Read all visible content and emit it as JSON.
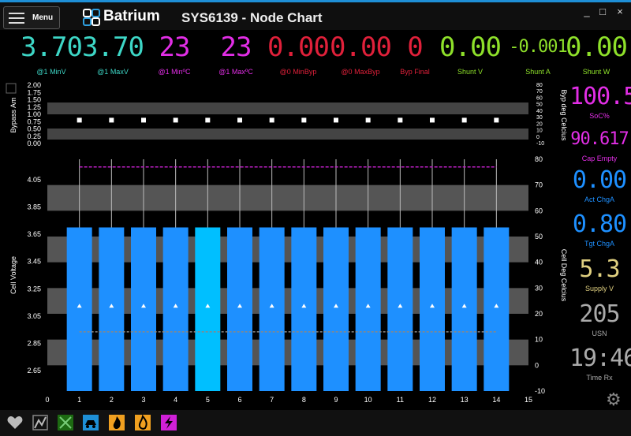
{
  "window": {
    "menu_label": "Menu",
    "brand": "Batrium",
    "title": "SYS6139 - Node Chart",
    "controls": [
      "_",
      "□",
      "×"
    ]
  },
  "colors": {
    "accent": "#1e8fd6",
    "cyan": "#3dd6c6",
    "magenta": "#e22ee6",
    "red": "#e0203a",
    "lime": "#8ee02a",
    "blue": "#1e90ff",
    "yellowish": "#e0d080",
    "gray": "#aaaaaa"
  },
  "readouts": [
    {
      "value": "3.70",
      "label": "@1 MinV",
      "color": "#3dd6c6"
    },
    {
      "value": "3.70",
      "label": "@1 MaxV",
      "color": "#3dd6c6"
    },
    {
      "value": "23",
      "label": "@1 MinºC",
      "color": "#e22ee6"
    },
    {
      "value": "23",
      "label": "@1 MaxºC",
      "color": "#e22ee6"
    },
    {
      "value": "0.00",
      "label": "@0 MinByp",
      "color": "#e0203a"
    },
    {
      "value": "0.00",
      "label": "@0 MaxByp",
      "color": "#e0203a"
    },
    {
      "value": "0",
      "label": "Byp Final",
      "color": "#e0203a"
    },
    {
      "value": "0.00",
      "label": "Shunt V",
      "color": "#8ee02a"
    },
    {
      "value": "-0.001",
      "label": "Shunt A",
      "color": "#8ee02a"
    },
    {
      "value": "0.00",
      "label": "Shunt W",
      "color": "#8ee02a"
    }
  ],
  "side": [
    {
      "value": "100.5",
      "label": "SoC%",
      "color": "#e22ee6"
    },
    {
      "value": "90.617",
      "label": "Cap Empty",
      "color": "#e22ee6"
    },
    {
      "value": "0.00",
      "label": "Act ChgA",
      "color": "#1e90ff"
    },
    {
      "value": "0.80",
      "label": "Tgt ChgA",
      "color": "#1e90ff"
    },
    {
      "value": "5.3",
      "label": "Supply V",
      "color": "#e0d080"
    },
    {
      "value": "205",
      "label": "USN",
      "color": "#aaaaaa"
    },
    {
      "value": "19:46",
      "label": "Time Rx",
      "color": "#aaaaaa"
    }
  ],
  "chart_data": [
    {
      "type": "scatter",
      "ylabel": "Bypass Am",
      "y2label": "Byp deg Celcius",
      "yticks": [
        "2.00",
        "1.75",
        "1.50",
        "1.25",
        "1.00",
        "0.75",
        "0.50",
        "0.25",
        "0.00"
      ],
      "y2ticks": [
        "80",
        "70",
        "60",
        "50",
        "40",
        "30",
        "20",
        "10",
        "0",
        "-10"
      ],
      "ylim": [
        0,
        2
      ],
      "y2lim": [
        -10,
        80
      ],
      "x": [
        1,
        2,
        3,
        4,
        5,
        6,
        7,
        8,
        9,
        10,
        11,
        12,
        13,
        14
      ],
      "values": [
        0.8,
        0.8,
        0.8,
        0.8,
        0.8,
        0.8,
        0.8,
        0.8,
        0.8,
        0.8,
        0.8,
        0.8,
        0.8,
        0.8
      ]
    },
    {
      "type": "bar",
      "ylabel": "Cell Voltage",
      "y2label": "Cell Deg Celcius",
      "yticks": [
        "4.05",
        "3.85",
        "3.65",
        "3.45",
        "3.25",
        "3.05",
        "2.85",
        "2.65"
      ],
      "y2ticks": [
        "80",
        "70",
        "60",
        "50",
        "40",
        "30",
        "20",
        "10",
        "0",
        "-10"
      ],
      "xticks": [
        "0",
        "1",
        "2",
        "3",
        "4",
        "5",
        "6",
        "7",
        "8",
        "9",
        "10",
        "11",
        "12",
        "13",
        "14",
        "15"
      ],
      "categories": [
        1,
        2,
        3,
        4,
        5,
        6,
        7,
        8,
        9,
        10,
        11,
        12,
        13,
        14
      ],
      "values": [
        3.7,
        3.7,
        3.7,
        3.7,
        3.7,
        3.7,
        3.7,
        3.7,
        3.7,
        3.7,
        3.7,
        3.7,
        3.7,
        3.7
      ],
      "highlighted": 5,
      "temps_c": [
        23,
        23,
        23,
        23,
        23,
        23,
        23,
        23,
        23,
        23,
        23,
        23,
        23,
        23
      ],
      "ylim": [
        2.5,
        4.2
      ],
      "y2lim": [
        -10,
        80
      ],
      "upper_limit_c": 77,
      "lower_limit_c": 13
    }
  ],
  "toolbar": [
    "heart-icon",
    "network-icon",
    "map-icon",
    "car-icon",
    "fire-icon",
    "flame-icon",
    "bolt-icon"
  ]
}
